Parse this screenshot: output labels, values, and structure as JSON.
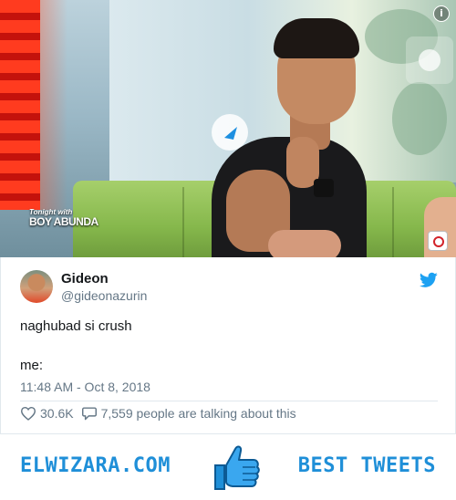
{
  "media": {
    "show_logo_line1": "Tonight with",
    "show_logo_line2": "BOY ABUNDA",
    "info_icon": "i",
    "icons": [
      "info-icon",
      "play-icon",
      "network-logo-icon"
    ]
  },
  "tweet": {
    "name": "Gideon",
    "handle": "@gideonazurin",
    "text_line1": "naghubad si crush",
    "text_line2": "me:",
    "timestamp": "11:48 AM - Oct 8, 2018",
    "likes": "30.6K",
    "talking": "7,559 people are talking about this",
    "brand_color": "#1da1f2"
  },
  "footer": {
    "left": "ELWIZARA.COM",
    "right": "BEST TWEETS",
    "accent": "#1f8fd8"
  }
}
